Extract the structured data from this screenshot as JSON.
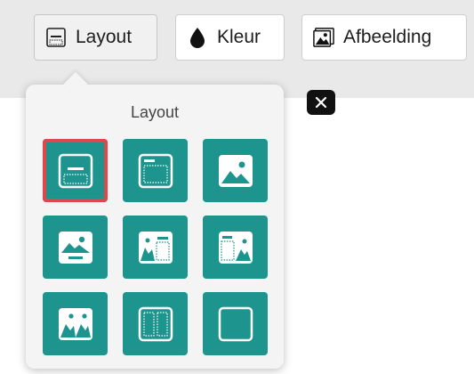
{
  "toolbar": {
    "layout_label": "Layout",
    "color_label": "Kleur",
    "image_label": "Afbeelding"
  },
  "popover": {
    "title": "Layout",
    "selected_index": 0,
    "options": [
      {
        "icon": "layout-text-bottom-icon"
      },
      {
        "icon": "layout-text-top-icon"
      },
      {
        "icon": "layout-image-full-icon"
      },
      {
        "icon": "layout-image-top-text-bottom-icon"
      },
      {
        "icon": "layout-image-left-text-right-icon"
      },
      {
        "icon": "layout-text-left-image-right-icon"
      },
      {
        "icon": "layout-two-images-icon"
      },
      {
        "icon": "layout-two-columns-icon"
      },
      {
        "icon": "layout-blank-icon"
      }
    ]
  },
  "colors": {
    "tile": "#1d948e",
    "selected_outline": "#e0474c"
  }
}
